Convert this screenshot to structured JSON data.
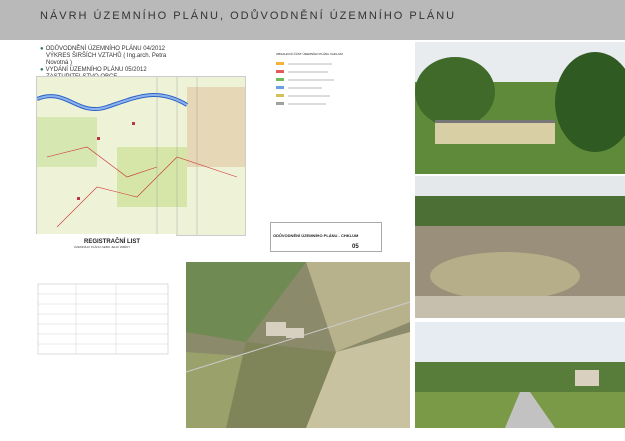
{
  "header": {
    "title": "NÁVRH ÚZEMNÍHO PLÁNU, ODŮVODNĚNÍ ÚZEMNÍHO PLÁNU"
  },
  "description": {
    "lines": [
      "ODŮVODNĚNÍ ÚZEMNÍHO PLÁNU 04/2012",
      "VÝKRES ŠIRŠÍCH VZTAHŮ ( Ing.arch. Petra Novotná )",
      "VYDÁNÍ ÚZEMNÍHO PLÁNU 05/2012",
      "ZASTUPITELSTVO OBCE"
    ]
  },
  "legend": {
    "title": "OBSAHOVÁ ČÁST ÚZEMNÍHO PLÁNU CHKLUM"
  },
  "document": {
    "title": "ODŮVODNĚNÍ ÚZEMNÍHO PLÁNU - CHKLUM",
    "number": "05"
  },
  "register": {
    "title": "REGISTRAČNÍ LIST",
    "subtitle": "ÚZEMNÍHO PLÁNU NEBO JEHO ZMĚNY"
  },
  "colors": {
    "header": "#b9b9b9",
    "accent": "#2b7d4f"
  }
}
